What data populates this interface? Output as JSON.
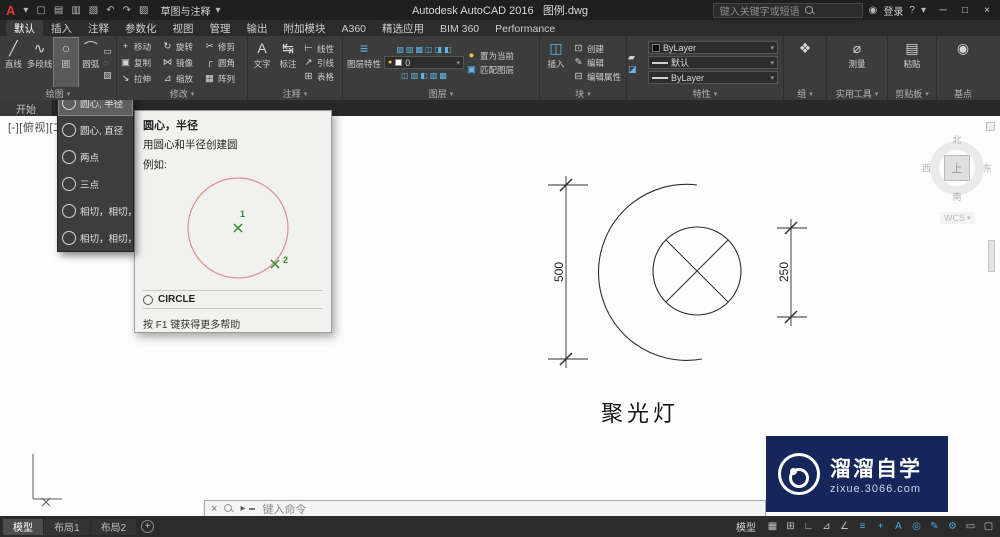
{
  "titlebar": {
    "workspace": "草图与注释",
    "title_app": "Autodesk AutoCAD 2016",
    "title_file": "图例.dwg",
    "search": "键入关键字或短语",
    "signin": "登录"
  },
  "tabs": [
    "默认",
    "插入",
    "注释",
    "参数化",
    "视图",
    "管理",
    "输出",
    "附加模块",
    "A360",
    "精选应用",
    "BIM 360",
    "Performance"
  ],
  "panels": {
    "draw": {
      "label": "绘图",
      "items": [
        "直线",
        "多段线",
        "圆",
        "圆弧"
      ]
    },
    "modify": {
      "label": "修改",
      "items": [
        "移动",
        "旋转",
        "修剪",
        "复制",
        "镜像",
        "圆角",
        "拉伸",
        "缩放",
        "阵列"
      ]
    },
    "annotate": {
      "label": "注释",
      "big": [
        "文字",
        "标注"
      ],
      "small": [
        "线性",
        "引线",
        "表格"
      ]
    },
    "layers": {
      "label": "图层",
      "big": "图层特性",
      "layer": "0",
      "small": [
        "置为当前",
        "匹配图层"
      ]
    },
    "block": {
      "label": "块",
      "big": "插入",
      "small": [
        "创建",
        "编辑",
        "编辑属性"
      ]
    },
    "props": {
      "label": "特性",
      "color": "ByLayer",
      "lweight": "默认",
      "ltype": "ByLayer"
    },
    "group": {
      "label": "组"
    },
    "util": {
      "label": "实用工具",
      "big": "测量"
    },
    "clip": {
      "label": "剪贴板",
      "big": "粘贴"
    },
    "base": {
      "label": "基点"
    }
  },
  "filetabs": {
    "start": "开始"
  },
  "menu": {
    "items": [
      "圆心, 半径",
      "圆心, 直径",
      "两点",
      "三点",
      "相切，相切，半径",
      "相切，相切，相切"
    ]
  },
  "tooltip": {
    "title": "圆心，半径",
    "desc": "用圆心和半径创建圆",
    "example": "例如:",
    "m1": "1",
    "m2": "2",
    "command": "CIRCLE",
    "help": "按 F1 键获得更多帮助"
  },
  "canvas": {
    "viewport": "[-][俯视][二维线框]",
    "dim_left": "500",
    "dim_right": "250",
    "caption": "聚光灯",
    "viewcube": {
      "n": "北",
      "s": "南",
      "w": "西",
      "e": "东",
      "top": "上",
      "wcs": "WCS"
    }
  },
  "cmdline": {
    "prompt": "键入命令"
  },
  "bottom": {
    "layouts": [
      "模型",
      "布局1",
      "布局2"
    ],
    "model": "模型"
  },
  "watermark": {
    "name": "溜溜自学",
    "url": "zixue.3066.com"
  },
  "colors": {
    "accent_blue": "#45a9e4",
    "watermark_bg": "#15265b",
    "canvas_bg": "#fdfdfd"
  },
  "icons": {
    "logo": "A",
    "caret": "▾",
    "win_min": "─",
    "win_max": "□",
    "win_close": "×",
    "qat": [
      "▢",
      "▤",
      "▥",
      "▧",
      "↶",
      "↷",
      "▨"
    ],
    "user": "◉",
    "help": "?",
    "draw": [
      "╱",
      "∿",
      "○",
      "⌒"
    ],
    "draw_small": [
      "▭",
      "◌",
      "▨"
    ],
    "modify": [
      "+",
      "↻",
      "✂",
      "▣",
      "⋈",
      "╭",
      "↘",
      "⊿",
      "▦"
    ],
    "annotate_big": [
      "A",
      "↹"
    ],
    "annotate_small": [
      "⊢",
      "↗",
      "⊞"
    ],
    "layers_big": "≡",
    "layers_row": [
      "▧",
      "▨",
      "▩",
      "◫",
      "◨",
      "◧"
    ],
    "layers_small": [
      "●",
      "▣"
    ],
    "block_big": "◫",
    "block_small": [
      "⊡",
      "✎",
      "⊟"
    ],
    "props": [
      "▰",
      "◪"
    ],
    "group": "❖",
    "util": "⌀",
    "clip": "▤",
    "base": "◉",
    "prompt": "▸",
    "status": [
      "▦",
      "⊞",
      "∟",
      "⊿",
      "∠",
      "≡",
      "+",
      "A",
      "◎",
      "✎",
      "⚙",
      "▭",
      "▢"
    ],
    "add": "+"
  }
}
